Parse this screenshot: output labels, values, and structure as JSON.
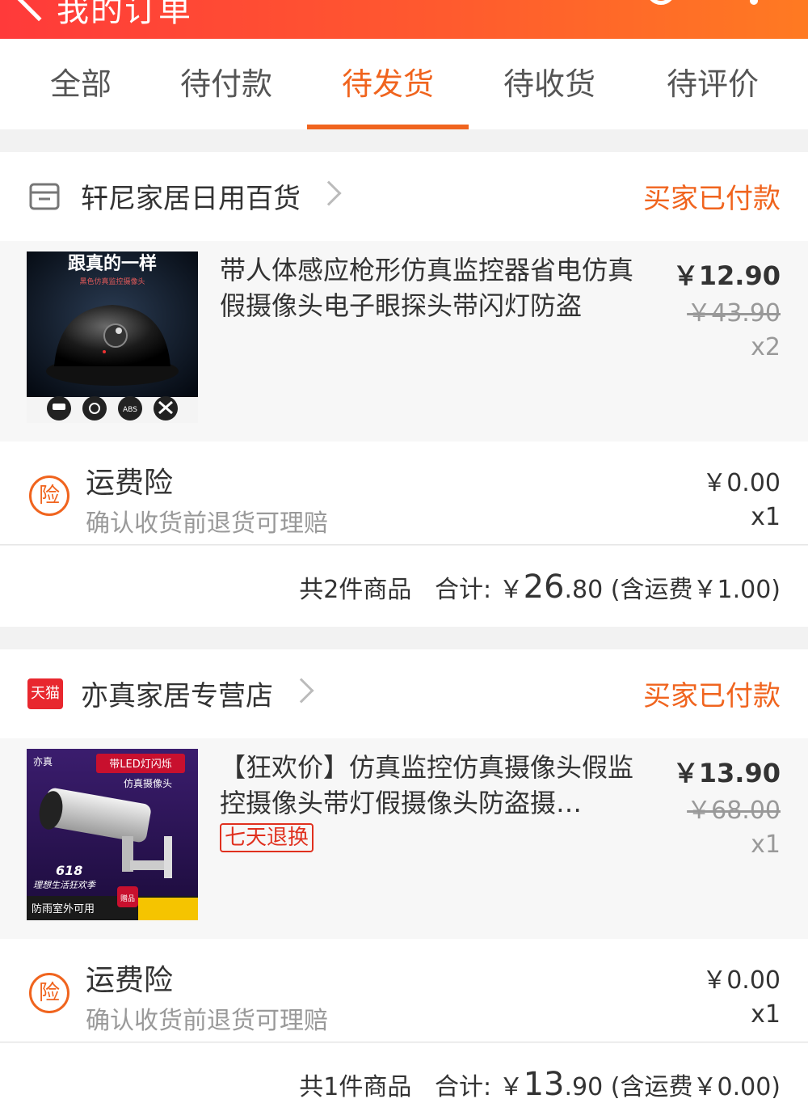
{
  "header": {
    "title": "我的订单",
    "colors": {
      "bar_start": "#ff3a3a",
      "bar_end": "#ff7a22",
      "accent": "#f0641e"
    }
  },
  "tabs": [
    {
      "label": "全部"
    },
    {
      "label": "待付款"
    },
    {
      "label": "待发货",
      "active": true
    },
    {
      "label": "待收货"
    },
    {
      "label": "待评价"
    }
  ],
  "orders": [
    {
      "shop_name": "轩尼家居日用百货",
      "shop_icon": "store-icon",
      "status": "买家已付款",
      "item": {
        "title": "带人体感应枪形仿真监控器省电仿真假摄像头电子眼探头带闪灯防盗",
        "price": "￥12.90",
        "original_price": "￥43.90",
        "qty": "x2",
        "thumb_text": "跟真的一样",
        "thumb_sub": "黑色仿真监控摄像头",
        "thumb_badges": [
          "dome-icon",
          "light-icon",
          "ABS",
          "wrench-icon"
        ]
      },
      "insurance": {
        "icon": "险",
        "title": "运费险",
        "desc": "确认收货前退货可理赔",
        "price": "￥0.00",
        "qty": "x1"
      },
      "summary": {
        "count": "共2件商品",
        "total_label": "合计:",
        "currency": "￥",
        "total_int": "26",
        "total_dec": ".80",
        "shipping": "(含运费￥1.00)"
      }
    },
    {
      "shop_name": "亦真家居专营店",
      "shop_icon": "tmall-icon",
      "shop_icon_text": "天猫",
      "status": "买家已付款",
      "item": {
        "title": "【狂欢价】仿真监控仿真摄像头假监控摄像头带灯假摄像头防盗摄…",
        "badge": "七天退换",
        "price": "￥13.90",
        "original_price": "￥68.00",
        "qty": "x1",
        "thumb_brand": "亦真",
        "thumb_tag": "带LED灯闪烁",
        "thumb_sub": "仿真摄像头",
        "thumb_promo": "理想生活狂欢季",
        "thumb_foot": "防雨室外可用",
        "thumb_gift": "赠品",
        "thumb_618": "618"
      },
      "insurance": {
        "icon": "险",
        "title": "运费险",
        "desc": "确认收货前退货可理赔",
        "price": "￥0.00",
        "qty": "x1"
      },
      "summary": {
        "count": "共1件商品",
        "total_label": "合计:",
        "currency": "￥",
        "total_int": "13",
        "total_dec": ".90",
        "shipping": "(含运费￥0.00)"
      }
    }
  ]
}
